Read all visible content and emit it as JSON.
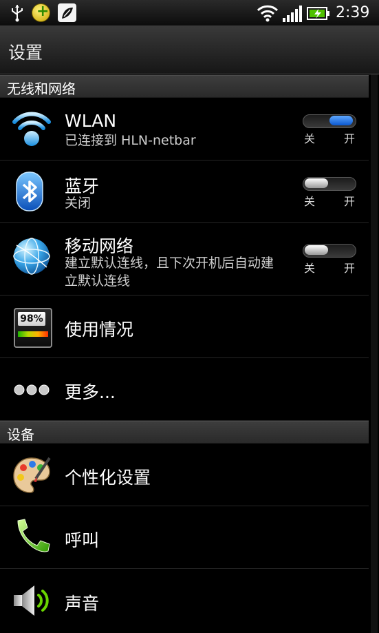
{
  "status_bar": {
    "time": "2:39",
    "icons": [
      "usb-icon",
      "app-icon",
      "app-icon",
      "wifi-icon",
      "signal-icon",
      "battery-charging-icon"
    ]
  },
  "header": {
    "title": "设置"
  },
  "sections": [
    {
      "title": "无线和网络",
      "items": [
        {
          "label": "WLAN",
          "sub": "已连接到 HLN-netbar",
          "icon": "wifi-icon",
          "toggle": true,
          "on": true
        },
        {
          "label": "蓝牙",
          "sub": "关闭",
          "icon": "bluetooth-icon",
          "toggle": true,
          "on": false
        },
        {
          "label": "移动网络",
          "sub": "建立默认连线，且下次开机后自动建立默认连线",
          "icon": "globe-icon",
          "toggle": true,
          "on": false
        },
        {
          "label": "使用情况",
          "icon": "usage-meter-icon",
          "meter": "98%"
        },
        {
          "label": "更多...",
          "icon": "more-dots-icon"
        }
      ]
    },
    {
      "title": "设备",
      "items": [
        {
          "label": "个性化设置",
          "icon": "palette-icon"
        },
        {
          "label": "呼叫",
          "icon": "phone-icon"
        },
        {
          "label": "声音",
          "icon": "speaker-icon"
        }
      ]
    }
  ],
  "toggle_labels": {
    "off": "关",
    "on": "开"
  },
  "colors": {
    "toggle_on": "#1a66e0",
    "background": "#000000"
  }
}
